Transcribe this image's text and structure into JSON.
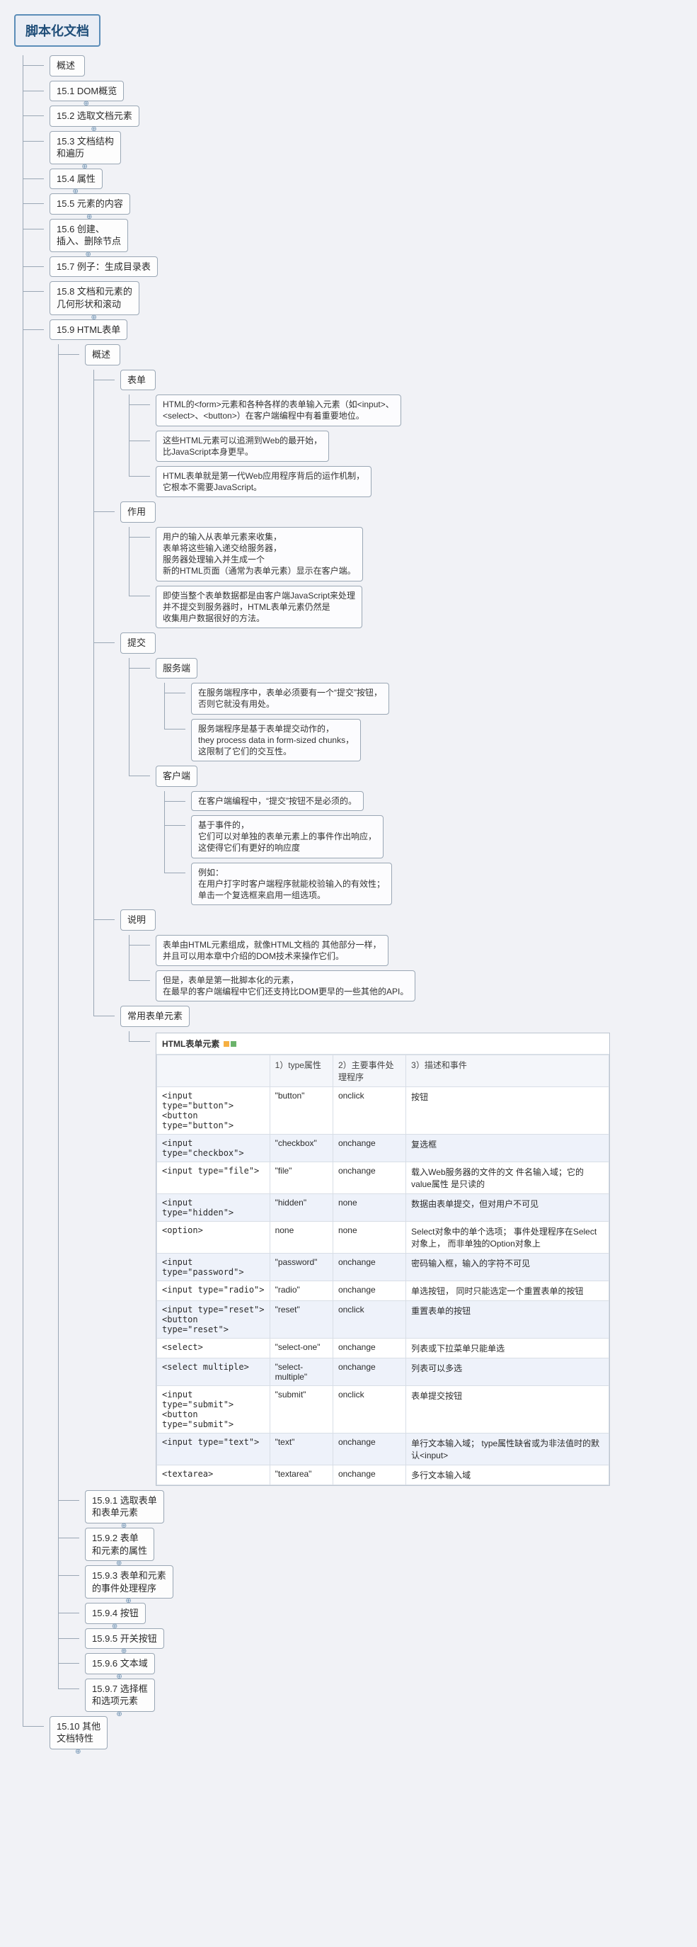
{
  "root": "脚本化文档",
  "top_nodes": [
    {
      "label": "概述",
      "expand": false
    },
    {
      "label": "15.1 DOM概览",
      "expand": true
    },
    {
      "label": "15.2 选取文档元素",
      "expand": true
    },
    {
      "label": "15.3 文档结构\n和遍历",
      "expand": true
    },
    {
      "label": "15.4 属性",
      "expand": true
    },
    {
      "label": "15.5 元素的内容",
      "expand": true
    },
    {
      "label": "15.6 创建、\n插入、删除节点",
      "expand": true
    },
    {
      "label": "15.7 例子：生成目录表",
      "expand": false
    },
    {
      "label": "15.8 文档和元素的\n几何形状和滚动",
      "expand": true
    }
  ],
  "n159": {
    "label": "15.9 HTML表单"
  },
  "overview": {
    "label": "概述"
  },
  "s_form": {
    "label": "表单"
  },
  "form_notes": [
    "HTML的<form>元素和各种各样的表单输入元素（如<input>、\n<select>、<button>）在客户端编程中有着重要地位。",
    "这些HTML元素可以追溯到Web的最开始，\n比JavaScript本身更早。",
    "HTML表单就是第一代Web应用程序背后的运作机制，\n它根本不需要JavaScript。"
  ],
  "s_use": {
    "label": "作用"
  },
  "use_notes": [
    "用户的输入从表单元素来收集，\n表单将这些输入递交给服务器，\n服务器处理输入并生成一个\n新的HTML页面（通常为表单元素）显示在客户端。",
    "即使当整个表单数据都是由客户端JavaScript来处理\n并不提交到服务器时，HTML表单元素仍然是\n收集用户数据很好的方法。"
  ],
  "s_submit": {
    "label": "提交"
  },
  "s_server": {
    "label": "服务端"
  },
  "server_notes": [
    "在服务端程序中，表单必须要有一个“提交”按钮，\n否则它就没有用处。",
    "服务端程序是基于表单提交动作的，\nthey process data in form-sized chunks，\n这限制了它们的交互性。"
  ],
  "s_client": {
    "label": "客户端"
  },
  "client_notes": [
    "在客户端编程中，“提交”按钮不是必须的。",
    "基于事件的，\n它们可以对单独的表单元素上的事件作出响应，\n这使得它们有更好的响应度",
    "例如：\n在用户打字时客户端程序就能校验输入的有效性；\n单击一个复选框来启用一组选项。"
  ],
  "s_desc": {
    "label": "说明"
  },
  "desc_notes": [
    "表单由HTML元素组成，就像HTML文档的 其他部分一样，\n并且可以用本章中介绍的DOM技术来操作它们。",
    "但是，表单是第一批脚本化的元素，\n在最早的客户端编程中它们还支持比DOM更早的一些其他的API。"
  ],
  "s_common": {
    "label": "常用表单元素"
  },
  "table": {
    "title": "HTML表单元素",
    "headers": [
      "",
      "1）type属性",
      "2）主要事件处理程序",
      "3）描述和事件"
    ],
    "rows": [
      {
        "alt": false,
        "c0": "<input type=\"button\">\n<button type=\"button\">",
        "c1": "\"button\"",
        "c2": "onclick",
        "c3": "按钮"
      },
      {
        "alt": true,
        "c0": "<input type=\"checkbox\">",
        "c1": "\"checkbox\"",
        "c2": "onchange",
        "c3": "复选框"
      },
      {
        "alt": false,
        "c0": "<input type=\"file\">",
        "c1": "\"file\"",
        "c2": "onchange",
        "c3": "载入Web服务器的文件的文\n件名输入域；它的value属性\n是只读的"
      },
      {
        "alt": true,
        "c0": "<input type=\"hidden\">",
        "c1": "\"hidden\"",
        "c2": "none",
        "c3": "数据由表单提交，但对用户不可见"
      },
      {
        "alt": false,
        "c0": "<option>",
        "c1": "none",
        "c2": "none",
        "c3": "Select对象中的单个选项；\n事件处理程序在Select对象上，\n而非单独的Option对象上"
      },
      {
        "alt": true,
        "c0": "<input type=\"password\">",
        "c1": "\"password\"",
        "c2": "onchange",
        "c3": "密码输入框，输入的字符不可见"
      },
      {
        "alt": false,
        "c0": "<input type=\"radio\">",
        "c1": "\"radio\"",
        "c2": "onchange",
        "c3": "单选按钮，\n同时只能选定一个重置表单的按钮"
      },
      {
        "alt": true,
        "c0": "<input type=\"reset\">\n<button type=\"reset\">",
        "c1": "\"reset\"",
        "c2": "onclick",
        "c3": "重置表单的按钮"
      },
      {
        "alt": false,
        "c0": "<select>",
        "c1": "\"select-one\"",
        "c2": "onchange",
        "c3": "列表或下拉菜单只能单选"
      },
      {
        "alt": true,
        "c0": "<select multiple>",
        "c1": "\"select-multiple\"",
        "c2": "onchange",
        "c3": "列表可以多选"
      },
      {
        "alt": false,
        "c0": "<input type=\"submit\">\n<button type=\"submit\">",
        "c1": "\"submit\"",
        "c2": "onclick",
        "c3": "表单提交按钮"
      },
      {
        "alt": true,
        "c0": "<input type=\"text\">",
        "c1": "\"text\"",
        "c2": "onchange",
        "c3": "单行文本输入域；\ntype属性缺省或为非法值时的默认<input>"
      },
      {
        "alt": false,
        "c0": "<textarea>",
        "c1": "\"textarea\"",
        "c2": "onchange",
        "c3": "多行文本输入域"
      }
    ]
  },
  "sub159": [
    {
      "label": "15.9.1 选取表单\n和表单元素",
      "expand": true
    },
    {
      "label": "15.9.2 表单\n和元素的属性",
      "expand": true
    },
    {
      "label": "15.9.3 表单和元素\n的事件处理程序",
      "expand": true
    },
    {
      "label": "15.9.4 按钮",
      "expand": true
    },
    {
      "label": "15.9.5 开关按钮",
      "expand": true
    },
    {
      "label": "15.9.6 文本域",
      "expand": true
    },
    {
      "label": "15.9.7 选择框\n和选项元素",
      "expand": true
    }
  ],
  "n1510": {
    "label": "15.10 其他\n文档特性",
    "expand": true
  }
}
